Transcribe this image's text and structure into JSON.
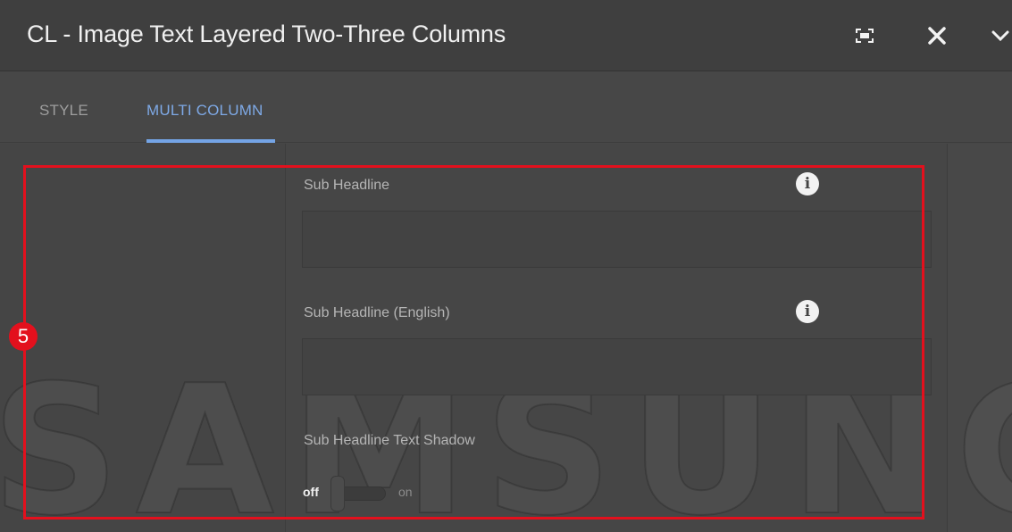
{
  "dialog": {
    "title": "CL - Image Text Layered Two-Three Columns",
    "header_icons": [
      "fullscreen-icon",
      "close-icon",
      "chevron-down-icon"
    ]
  },
  "tabs": [
    {
      "label": "STYLE",
      "active": false
    },
    {
      "label": "MULTI COLUMN",
      "active": true
    }
  ],
  "form": {
    "sub_headline": {
      "label": "Sub Headline",
      "value": "",
      "info_icon": "info-icon"
    },
    "sub_headline_english": {
      "label": "Sub Headline (English)",
      "value": "",
      "info_icon": "info-icon"
    },
    "text_shadow": {
      "label": "Sub Headline Text Shadow",
      "off_label": "off",
      "on_label": "on",
      "state": "off"
    }
  },
  "watermark": "SAMSUNG",
  "annotation": {
    "number": "5",
    "color": "#e3101d"
  },
  "colors": {
    "accent_tab": "#74a4e6",
    "background": "#474747",
    "header": "#3f3f3f"
  }
}
